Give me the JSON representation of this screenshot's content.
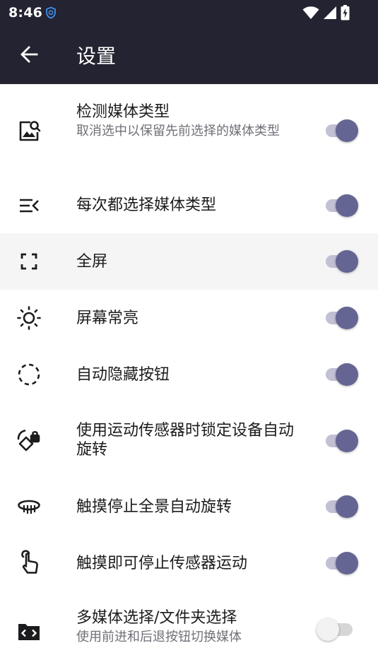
{
  "status_bar": {
    "time": "8:46",
    "icons": [
      "app-notification-icon",
      "wifi-icon",
      "cellular-signal-icon",
      "battery-charging-icon"
    ]
  },
  "app_bar": {
    "title": "设置",
    "back_icon": "arrow-back-icon"
  },
  "settings": [
    {
      "title": "检测媒体类型",
      "summary": "取消选中以保留先前选择的媒体类型",
      "icon": "image-search-icon",
      "enabled": true
    },
    {
      "title": "每次都选择媒体类型",
      "summary": "",
      "icon": "menu-open-icon",
      "enabled": true
    },
    {
      "title": "全屏",
      "summary": "",
      "icon": "fullscreen-icon",
      "enabled": true
    },
    {
      "title": "屏幕常亮",
      "summary": "",
      "icon": "brightness-icon",
      "enabled": true
    },
    {
      "title": "自动隐藏按钮",
      "summary": "",
      "icon": "dashed-circle-icon",
      "enabled": true
    },
    {
      "title": "使用运动传感器时锁定设备自动旋转",
      "summary": "",
      "icon": "screen-lock-rotation-icon",
      "enabled": true
    },
    {
      "title": "触摸停止全景自动旋转",
      "summary": "",
      "icon": "panorama-360-icon",
      "enabled": true
    },
    {
      "title": "触摸即可停止传感器运动",
      "summary": "",
      "icon": "touch-hand-icon",
      "enabled": true
    },
    {
      "title": "多媒体选择/文件夹选择",
      "summary": "使用前进和后退按钮切换媒体",
      "icon": "folder-code-icon",
      "enabled": false
    }
  ],
  "colors": {
    "bar_background": "#232331",
    "toggle_on_thumb": "#646593",
    "toggle_on_track": "#c1c0d5",
    "toggle_off_thumb": "#f2f2f2",
    "toggle_off_track": "#d6d6d6"
  }
}
